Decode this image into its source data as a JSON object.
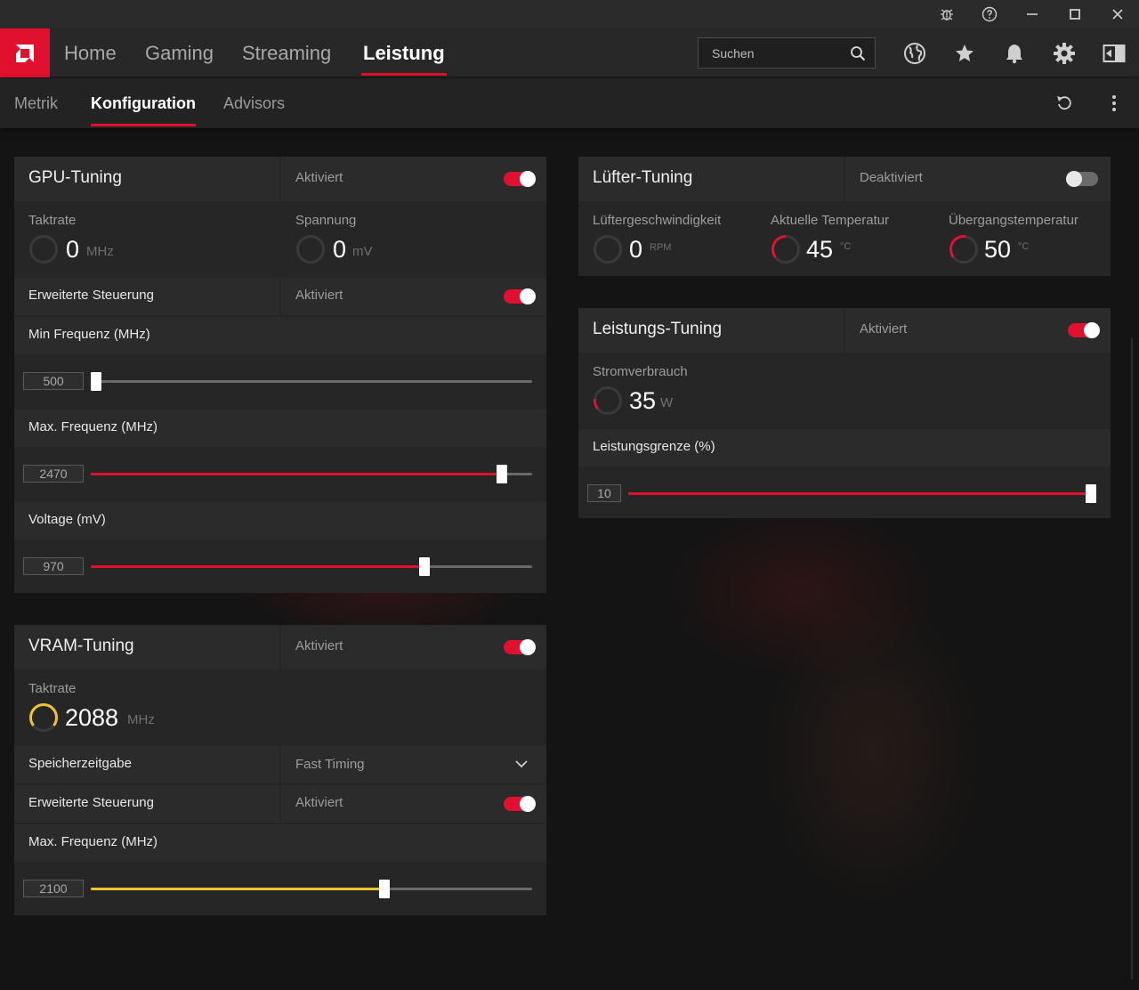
{
  "colors": {
    "accent": "#e0102e",
    "vram_accent": "#f2c232",
    "slider_track": "#6a6a6a"
  },
  "titlebar": {
    "icons": [
      "bug-icon",
      "help-icon",
      "minimize-icon",
      "maximize-icon",
      "close-icon"
    ]
  },
  "nav": {
    "items": [
      {
        "label": "Home"
      },
      {
        "label": "Gaming"
      },
      {
        "label": "Streaming"
      },
      {
        "label": "Leistung"
      }
    ],
    "active": "Leistung",
    "search_placeholder": "Suchen",
    "right_icons": [
      "globe-icon",
      "star-icon",
      "bell-icon",
      "gear-icon",
      "sidebar-icon"
    ]
  },
  "subnav": {
    "items": [
      {
        "label": "Metrik"
      },
      {
        "label": "Konfiguration"
      },
      {
        "label": "Advisors"
      }
    ],
    "active": "Konfiguration",
    "right_icons": [
      "reset-icon",
      "more-vertical-icon"
    ]
  },
  "gpu_tuning": {
    "title": "GPU-Tuning",
    "state": "Aktiviert",
    "enabled": true,
    "clock": {
      "label": "Taktrate",
      "value": "0",
      "unit": "MHz"
    },
    "voltage": {
      "label": "Spannung",
      "value": "0",
      "unit": "mV"
    },
    "advanced": {
      "label": "Erweiterte Steuerung",
      "state": "Aktiviert",
      "enabled": true
    },
    "min_freq": {
      "label": "Min Frequenz (MHz)",
      "value": "500",
      "fraction": 0.0
    },
    "max_freq": {
      "label": "Max. Frequenz (MHz)",
      "value": "2470",
      "fraction": 0.932
    },
    "voltage_slider": {
      "label": "Voltage (mV)",
      "value": "970",
      "fraction": 0.756
    }
  },
  "vram_tuning": {
    "title": "VRAM-Tuning",
    "state": "Aktiviert",
    "enabled": true,
    "clock": {
      "label": "Taktrate",
      "value": "2088",
      "unit": "MHz"
    },
    "timing": {
      "label": "Speicherzeitgabe",
      "value": "Fast Timing"
    },
    "advanced": {
      "label": "Erweiterte Steuerung",
      "state": "Aktiviert",
      "enabled": true
    },
    "max_freq": {
      "label": "Max. Frequenz (MHz)",
      "value": "2100",
      "fraction": 0.665
    }
  },
  "fan_tuning": {
    "title": "Lüfter-Tuning",
    "state": "Deaktiviert",
    "enabled": false,
    "fan_speed": {
      "label": "Lüftergeschwindigkeit",
      "value": "0",
      "unit": "RPM"
    },
    "current_temp": {
      "label": "Aktuelle Temperatur",
      "value": "45",
      "unit": "°C"
    },
    "junction_temp": {
      "label": "Übergangstemperatur",
      "value": "50",
      "unit": "°C"
    }
  },
  "power_tuning": {
    "title": "Leistungs-Tuning",
    "state": "Aktiviert",
    "enabled": true,
    "consumption": {
      "label": "Stromverbrauch",
      "value": "35",
      "unit": "W"
    },
    "limit": {
      "label": "Leistungsgrenze (%)",
      "value": "10",
      "fraction": 1.0
    }
  }
}
